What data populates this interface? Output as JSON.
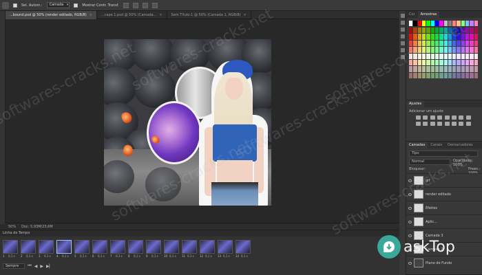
{
  "options": {
    "auto_select_label": "Sel. Autom.:",
    "layer_select": "Camada",
    "show_transform_label": "Mostrar Contr. Transf."
  },
  "tabs": [
    {
      "label": "...bound.psd @ 50% (render editado, RGB/8)",
      "close": "×"
    },
    {
      "label": "...capa 1.psd @ 50% (Camada...",
      "close": "×"
    },
    {
      "label": "Sem Título-1 @ 50% (Camada 1, RGB/8)",
      "close": "×"
    }
  ],
  "status": {
    "zoom": "50%",
    "doc": "Doc: 5,93M/23,6M"
  },
  "timeline": {
    "title": "Linha do Tempo",
    "frames": [
      {
        "num": "1",
        "delay": "0,1 s"
      },
      {
        "num": "2",
        "delay": "0,1 s"
      },
      {
        "num": "3",
        "delay": "0,1 s"
      },
      {
        "num": "4",
        "delay": "0,1 s"
      },
      {
        "num": "5",
        "delay": "0,1 s"
      },
      {
        "num": "6",
        "delay": "0,1 s"
      },
      {
        "num": "7",
        "delay": "0,1 s"
      },
      {
        "num": "8",
        "delay": "0,1 s"
      },
      {
        "num": "9",
        "delay": "0,1 s"
      },
      {
        "num": "10",
        "delay": "0,1 s"
      },
      {
        "num": "11",
        "delay": "0,1 s"
      },
      {
        "num": "12",
        "delay": "0,1 s"
      },
      {
        "num": "13",
        "delay": "0,1 s"
      },
      {
        "num": "14",
        "delay": "0,1 s"
      }
    ],
    "selected_frame": 4,
    "loop_label": "Sempre",
    "controls": [
      "⏮",
      "◀",
      "▶",
      "▶▏"
    ]
  },
  "panels": {
    "color_tabs": [
      "Cor",
      "Amostras"
    ],
    "swatch_colors": [
      "#ffffff",
      "#000000",
      "#ff0000",
      "#ffff00",
      "#00ff00",
      "#00ffff",
      "#0000ff",
      "#ff00ff",
      "#c0c0c0",
      "#808080",
      "#ff8080",
      "#ffc080",
      "#80ff80",
      "#80c0ff",
      "#c080ff",
      "#ff80c0"
    ],
    "adjust_tab": "Ajustes",
    "adjust_hint": "Adicionar um ajuste",
    "layers_tabs": [
      "Camadas",
      "Canais",
      "Demarcadores"
    ],
    "kind_label": "Tipo",
    "blend_mode": "Normal",
    "opacity_label": "Opacidade: 100%",
    "lock_label": "Bloquear:",
    "fill_label": "Preen.: 100%",
    "layers": [
      {
        "name": "gif"
      },
      {
        "name": "render editado"
      },
      {
        "name": "Efeitos"
      },
      {
        "name": "Aplic..."
      },
      {
        "name": "Camada 3"
      },
      {
        "name": "Camada 2"
      },
      {
        "name": "Plano de Fundo"
      }
    ]
  },
  "watermark": {
    "text": "softwares-cracks.net",
    "logo_text": "askTop"
  }
}
